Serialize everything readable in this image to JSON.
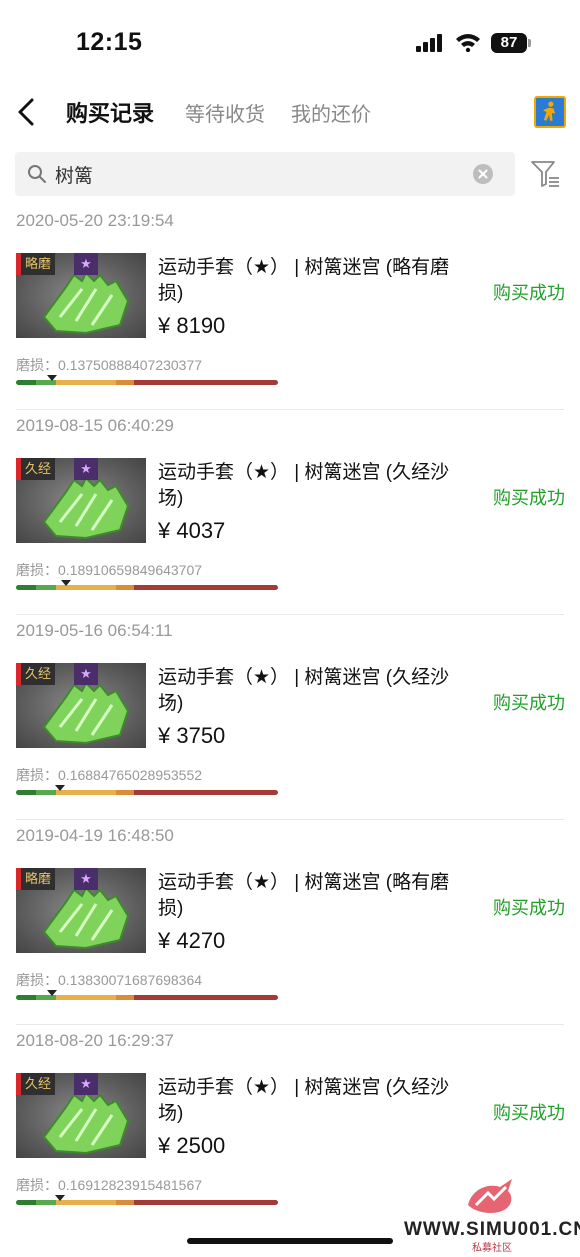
{
  "status_bar": {
    "time": "12:15",
    "battery": "87"
  },
  "nav": {
    "tabs": [
      {
        "label": "购买记录",
        "active": true
      },
      {
        "label": "等待收货",
        "active": false
      },
      {
        "label": "我的还价",
        "active": false
      }
    ],
    "back_icon": "chevron-left-icon",
    "game_icon": "cs-game-icon"
  },
  "search": {
    "value": "树篱",
    "icon": "search-icon",
    "clear_icon": "clear-icon",
    "filter_icon": "filter-icon"
  },
  "colors": {
    "success": "#22a12a",
    "wear_tag_border": "#d8262a"
  },
  "records": [
    {
      "date": "2020-05-20 23:19:54",
      "tag": "略磨",
      "star": "★",
      "name": "运动手套（★） | 树篱迷宫 (略有磨损)",
      "price": "¥ 8190",
      "status": "购买成功",
      "wear_label": "磨损：0.13750888407230377",
      "wear_value": 0.13750888407230377
    },
    {
      "date": "2019-08-15 06:40:29",
      "tag": "久经",
      "star": "★",
      "name": "运动手套（★） | 树篱迷宫 (久经沙场)",
      "price": "¥ 4037",
      "status": "购买成功",
      "wear_label": "磨损：0.18910659849643707",
      "wear_value": 0.18910659849643707
    },
    {
      "date": "2019-05-16 06:54:11",
      "tag": "久经",
      "star": "★",
      "name": "运动手套（★） | 树篱迷宫 (久经沙场)",
      "price": "¥ 3750",
      "status": "购买成功",
      "wear_label": "磨损：0.16884765028953552",
      "wear_value": 0.16884765028953552
    },
    {
      "date": "2019-04-19 16:48:50",
      "tag": "略磨",
      "star": "★",
      "name": "运动手套（★） | 树篱迷宫 (略有磨损)",
      "price": "¥ 4270",
      "status": "购买成功",
      "wear_label": "磨损：0.13830071687698364",
      "wear_value": 0.13830071687698364
    },
    {
      "date": "2018-08-20 16:29:37",
      "tag": "久经",
      "star": "★",
      "name": "运动手套（★） | 树篱迷宫 (久经沙场)",
      "price": "¥ 2500",
      "status": "购买成功",
      "wear_label": "磨损：0.16912823915481567",
      "wear_value": 0.16912823915481567
    }
  ],
  "watermark": {
    "text": "WWW.SIMU001.CN",
    "sub": "私募社区"
  }
}
